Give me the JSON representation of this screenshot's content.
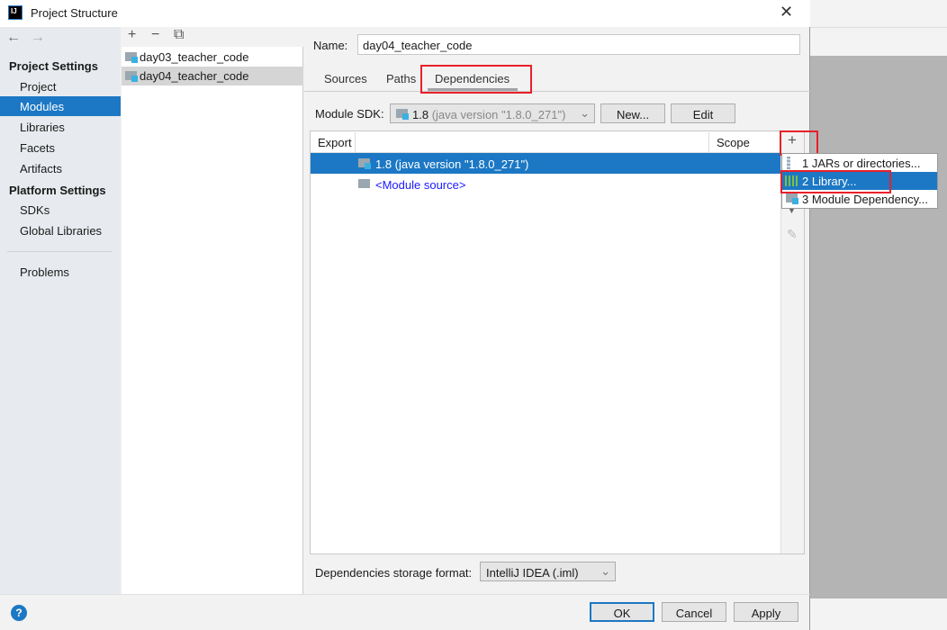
{
  "window": {
    "title": "Project Structure",
    "logo": "IJ",
    "close": "✕"
  },
  "nav": {
    "back": "←",
    "forward": "→"
  },
  "sidebar": {
    "project_settings": "Project Settings",
    "platform_settings": "Platform Settings",
    "items": [
      {
        "label": "Project"
      },
      {
        "label": "Modules"
      },
      {
        "label": "Libraries"
      },
      {
        "label": "Facets"
      },
      {
        "label": "Artifacts"
      },
      {
        "label": "SDKs"
      },
      {
        "label": "Global Libraries"
      },
      {
        "label": "Problems"
      }
    ],
    "selected": "Modules"
  },
  "modules": {
    "toolbar": {
      "add": "+",
      "remove": "−",
      "copy": "⧉"
    },
    "items": [
      {
        "label": "day03_teacher_code"
      },
      {
        "label": "day04_teacher_code"
      }
    ],
    "selected": "day04_teacher_code"
  },
  "detail": {
    "name_label": "Name:",
    "name_value": "day04_teacher_code",
    "tabs": [
      {
        "label": "Sources"
      },
      {
        "label": "Paths"
      },
      {
        "label": "Dependencies"
      }
    ],
    "active_tab": "Dependencies",
    "sdk_label": "Module SDK:",
    "sdk_value": "1.8",
    "sdk_detail": "(java version \"1.8.0_271\")",
    "new_button": "New...",
    "edit_button": "Edit",
    "table": {
      "headers": {
        "export": "Export",
        "scope": "Scope"
      },
      "rows": [
        {
          "label": "1.8 (java version \"1.8.0_271\")"
        },
        {
          "label": "<Module source>"
        }
      ]
    },
    "add_button": "+",
    "menu": [
      {
        "label": "1  JARs or directories..."
      },
      {
        "label": "2  Library..."
      },
      {
        "label": "3  Module Dependency..."
      }
    ],
    "storage_label": "Dependencies storage format:",
    "storage_value": "IntelliJ IDEA (.iml)"
  },
  "footer": {
    "help": "?",
    "ok": "OK",
    "cancel": "Cancel",
    "apply": "Apply"
  },
  "colors": {
    "accent": "#1c78c4",
    "highlight": "#e8202a",
    "link": "#1a1aff"
  }
}
